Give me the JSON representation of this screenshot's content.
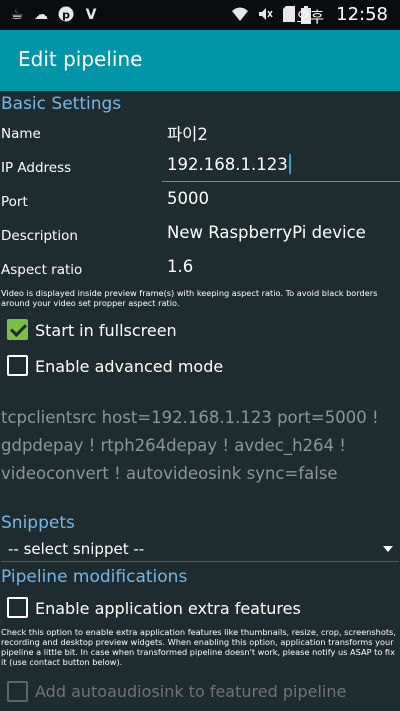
{
  "status_bar": {
    "ampm": "오후",
    "time": "12:58",
    "icons": [
      "coffee-icon",
      "cloud-icon",
      "pinterest-icon",
      "v-app-icon",
      "wifi-icon",
      "mute-icon",
      "sd-card-icon",
      "battery-icon"
    ]
  },
  "app_bar": {
    "title": "Edit pipeline"
  },
  "basic_settings": {
    "heading": "Basic Settings",
    "name_label": "Name",
    "name_value": "파이2",
    "ip_label": "IP Address",
    "ip_value": "192.168.1.123",
    "port_label": "Port",
    "port_value": "5000",
    "description_label": "Description",
    "description_value": "New RaspberryPi device",
    "aspect_label": "Aspect ratio",
    "aspect_value": "1.6",
    "aspect_hint": "Video is displayed inside preview frame(s) with keeping aspect ratio. To avoid black borders around your video set propper aspect ratio.",
    "fullscreen_label": "Start in fullscreen",
    "fullscreen_checked": true,
    "advanced_label": "Enable advanced mode",
    "advanced_checked": false,
    "pipeline": "tcpclientsrc host=192.168.1.123 port=5000 ! gdpdepay ! rtph264depay ! avdec_h264 ! videoconvert ! autovideosink sync=false"
  },
  "snippets": {
    "heading": "Snippets",
    "selected": "-- select snippet --"
  },
  "pipeline_modifications": {
    "heading": "Pipeline modifications",
    "extra_label": "Enable application extra features",
    "extra_checked": false,
    "extra_hint": "Check this option to enable extra application features like thumbnails, resize, crop, screenshots, recording and desktop preview widgets. When enabling this option, application transforms your pipeline a little bit. In case when transformed pipeline doesn't work, please notify us ASAP to fix it (use contact button below).",
    "audio_label": "Add autoaudiosink to featured pipeline",
    "audio_checked": false
  },
  "colors": {
    "app_bar": "#0096a7",
    "background": "#1e2b2f",
    "section_heading": "#74b8e9",
    "checkbox_checked": "#7bc043"
  }
}
